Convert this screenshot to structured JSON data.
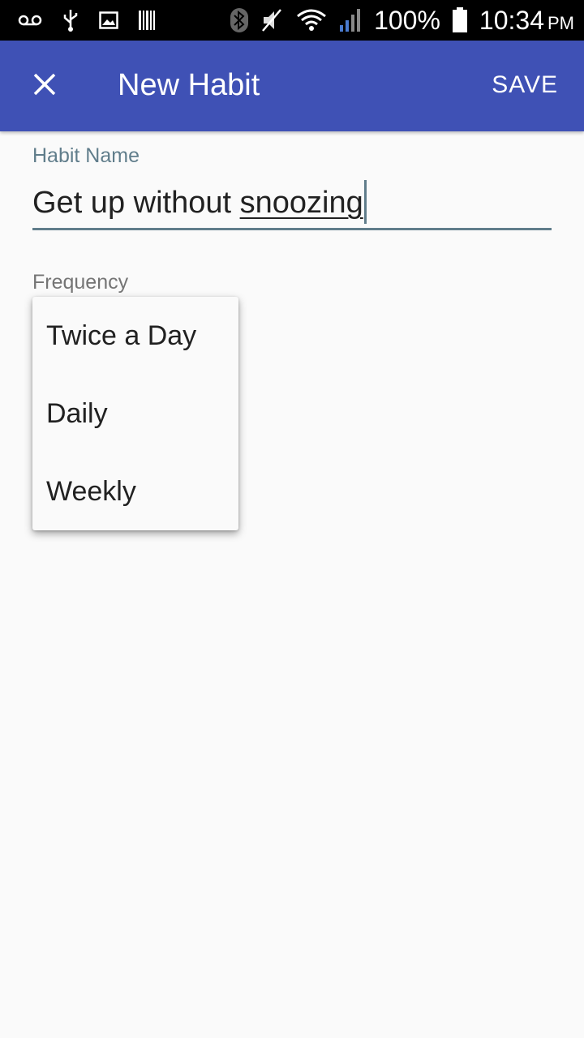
{
  "status_bar": {
    "icons_left": [
      "voicemail-icon",
      "usb-icon",
      "image-icon",
      "barcode-icon"
    ],
    "icons_right": [
      "bluetooth-icon",
      "mute-icon",
      "wifi-icon",
      "signal-icon",
      "battery-icon"
    ],
    "battery": "100%",
    "time": "10:34",
    "ampm": "PM"
  },
  "app_bar": {
    "close_icon": "close-icon",
    "title": "New Habit",
    "save_label": "SAVE",
    "color": "#3f51b5"
  },
  "form": {
    "habit_name_label": "Habit Name",
    "habit_name_value_part1": "Get up without ",
    "habit_name_value_part2": "snoozing",
    "frequency_label": "Frequency",
    "frequency_options": [
      "Twice a Day",
      "Daily",
      "Weekly"
    ]
  }
}
